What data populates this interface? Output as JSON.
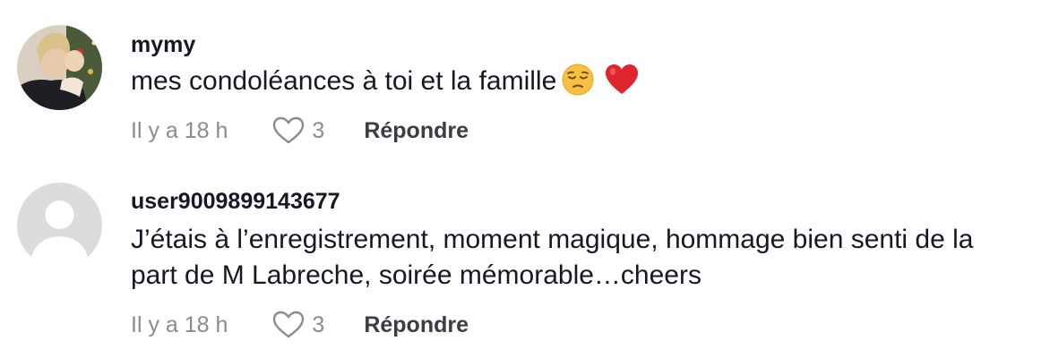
{
  "comments": [
    {
      "username": "mymy",
      "text": "mes condoléances à toi et la famille",
      "emojis": [
        "pensive-face-emoji",
        "red-heart-emoji"
      ],
      "time": "Il y a 18 h",
      "likes": "3",
      "reply_label": "Répondre",
      "avatar": "user-photo"
    },
    {
      "username": "user9009899143677",
      "text": "J’étais à l’enregistrement, moment magique, hommage bien senti de la part de M Labreche, soirée mémorable…cheers",
      "time": "Il y a 18 h",
      "likes": "3",
      "reply_label": "Répondre",
      "avatar": "default-avatar"
    }
  ],
  "colors": {
    "text": "#161823",
    "meta": "#8a8b91",
    "reply": "#3b3c44",
    "heart": "#e0242b",
    "emoji_face": "#f7c043",
    "default_avatar_bg": "#dcdcdc"
  }
}
